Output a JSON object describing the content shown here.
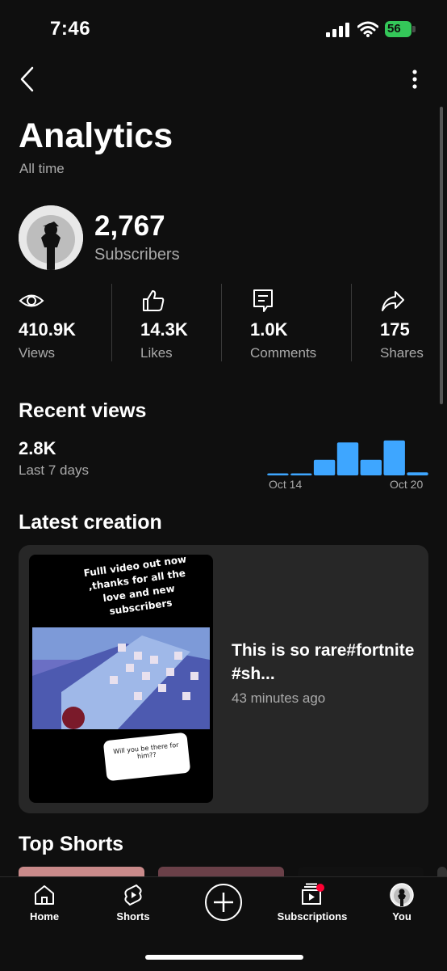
{
  "status_bar": {
    "time": "7:46",
    "battery": "56"
  },
  "header": {
    "title": "Analytics",
    "subtitle": "All time"
  },
  "channel": {
    "subscriber_count": "2,767",
    "subscriber_label": "Subscribers"
  },
  "stats": [
    {
      "icon": "eye-icon",
      "value": "410.9K",
      "label": "Views"
    },
    {
      "icon": "thumbs-up-icon",
      "value": "14.3K",
      "label": "Likes"
    },
    {
      "icon": "comment-icon",
      "value": "1.0K",
      "label": "Comments"
    },
    {
      "icon": "share-icon",
      "value": "175",
      "label": "Shares"
    }
  ],
  "recent_views": {
    "title": "Recent views",
    "value": "2.8K",
    "period": "Last 7 days",
    "x_start_label": "Oct 14",
    "x_end_label": "Oct 20"
  },
  "chart_data": {
    "type": "bar",
    "title": "Recent views",
    "categories": [
      "Oct 14",
      "",
      "",
      "",
      "",
      "",
      "Oct 20"
    ],
    "values": [
      0.05,
      0.05,
      0.4,
      0.85,
      0.4,
      0.9,
      0.08
    ],
    "color": "#3ea6ff",
    "grid": false
  },
  "latest_creation": {
    "title": "Latest creation",
    "thumbnail_caption": "Fulll video out now ,thanks for all the love and new subscribers",
    "thumbnail_question": "Will you be there for him??",
    "video_title": "This is so rare#fortnite #sh...",
    "posted": "43 minutes ago"
  },
  "top_shorts": {
    "title": "Top Shorts"
  },
  "nav": {
    "home": "Home",
    "shorts": "Shorts",
    "subscriptions": "Subscriptions",
    "you": "You"
  },
  "colors": {
    "background": "#0f0f0f",
    "card": "#272727",
    "accent": "#3ea6ff",
    "secondary_text": "#aaaaaa",
    "battery": "#34c759"
  }
}
